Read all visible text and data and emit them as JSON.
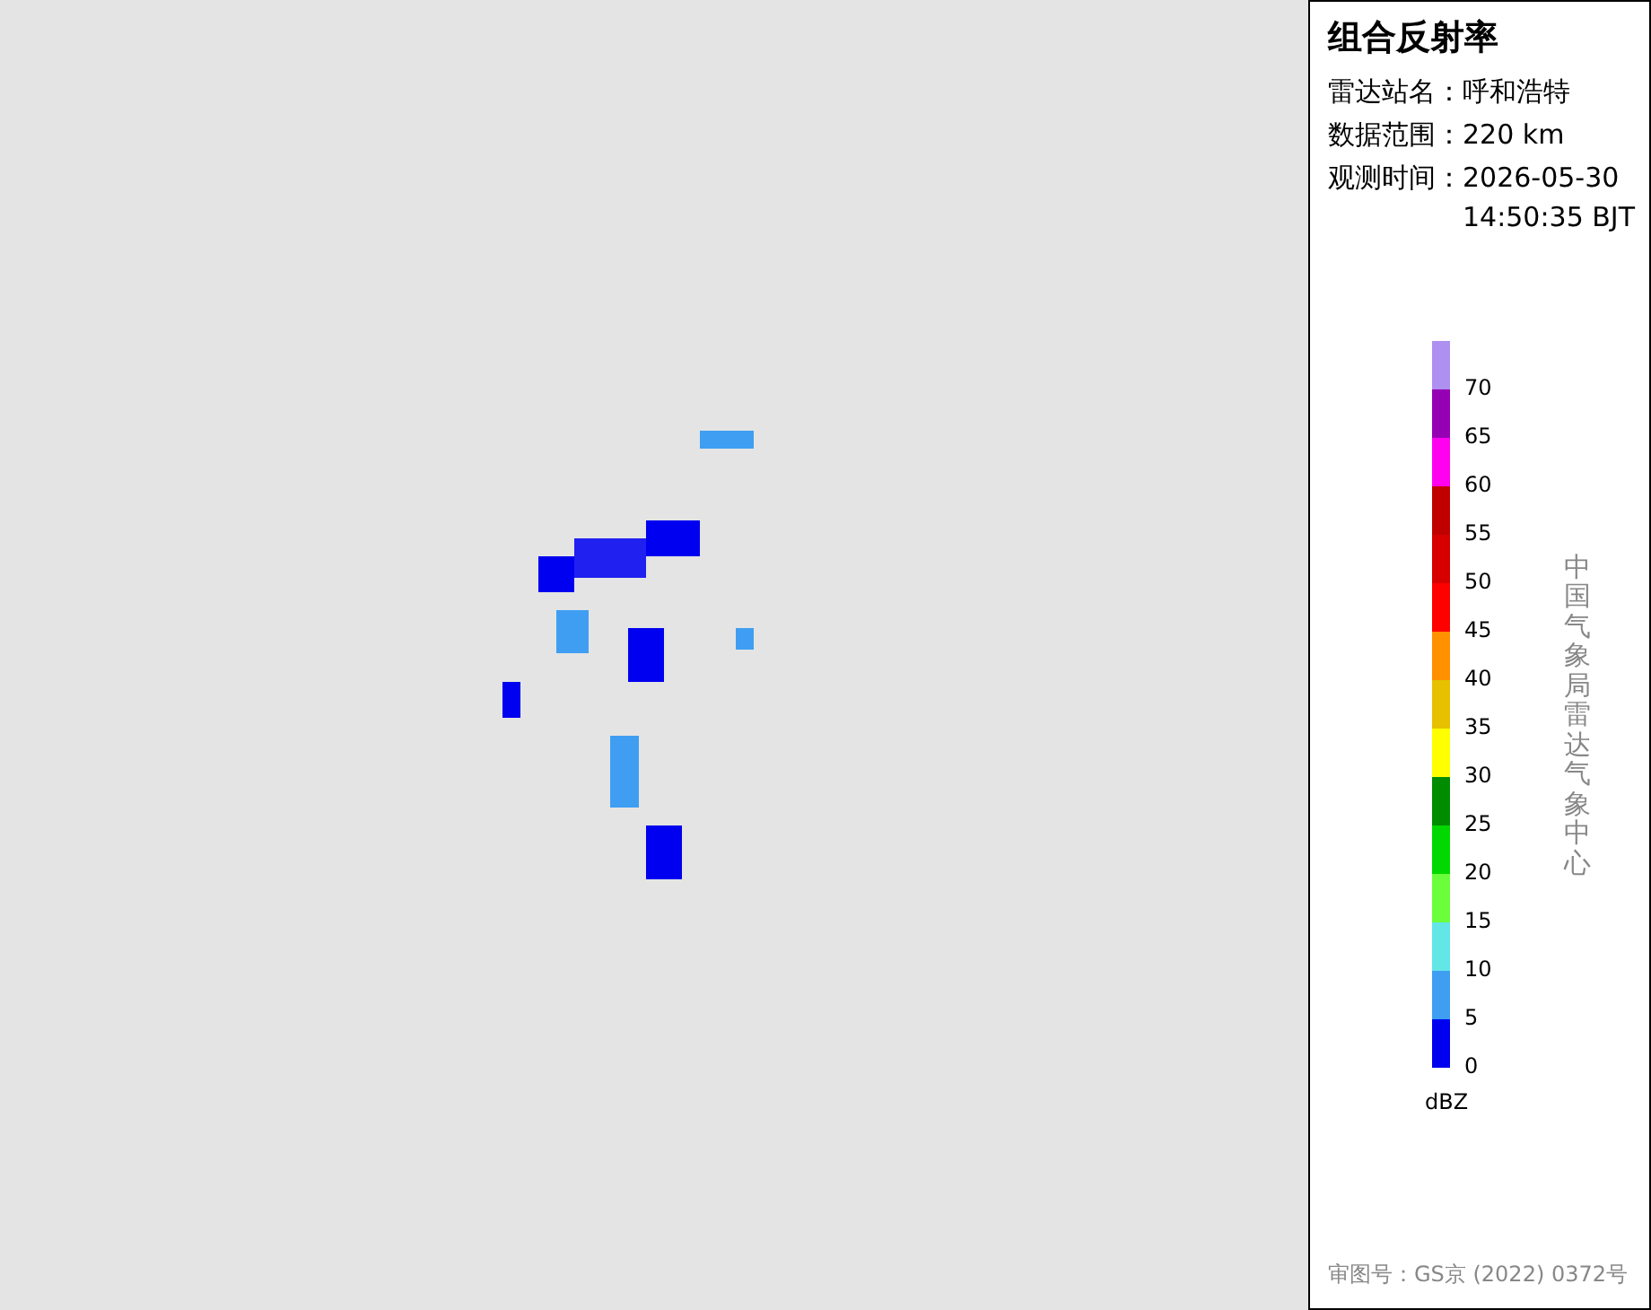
{
  "panel": {
    "title": "组合反射率",
    "fields": [
      {
        "label": "雷达站名：",
        "value": "呼和浩特"
      },
      {
        "label": "数据范围：",
        "value": "220 km"
      },
      {
        "label": "观测时间：",
        "value": "2026-05-30 14:50:35 BJT"
      }
    ],
    "legend": {
      "bins": [
        {
          "label": "70",
          "color": "#ad90f0"
        },
        {
          "label": "65",
          "color": "#9600b4"
        },
        {
          "label": "60",
          "color": "#ff00f0"
        },
        {
          "label": "55",
          "color": "#c00000"
        },
        {
          "label": "50",
          "color": "#d60000"
        },
        {
          "label": "45",
          "color": "#ff0000"
        },
        {
          "label": "40",
          "color": "#ff9000"
        },
        {
          "label": "35",
          "color": "#e7c000"
        },
        {
          "label": "30",
          "color": "#ffff00"
        },
        {
          "label": "25",
          "color": "#008c00"
        },
        {
          "label": "20",
          "color": "#00d800"
        },
        {
          "label": "15",
          "color": "#6bff3b"
        },
        {
          "label": "10",
          "color": "#63e6e6"
        },
        {
          "label": "5",
          "color": "#3f9ef2"
        },
        {
          "label": "0",
          "color": "#0000f0"
        }
      ],
      "unit": "dBZ"
    },
    "credit": "中国气象局雷达气象中心",
    "approval": "审图号：GS京 (2022) 0372号"
  }
}
